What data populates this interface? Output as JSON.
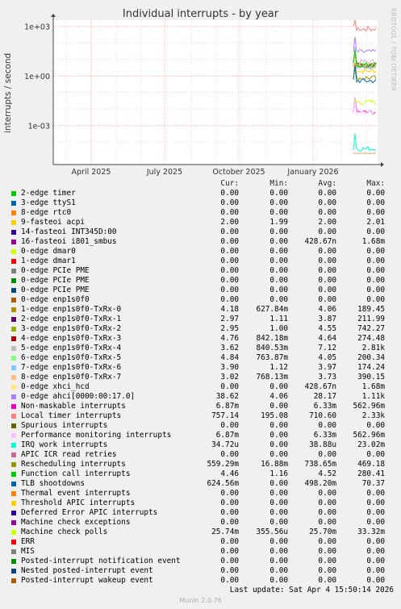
{
  "title": "Individual interrupts - by year",
  "side_label": "RRDTOOL / TOBI OETIKER",
  "footer": "Last update: Sat Apr  4 15:50:14 2026",
  "munin": "Munin 2.0.76",
  "legend_headers": {
    "cur": "Cur:",
    "min": "Min:",
    "avg": "Avg:",
    "max": "Max:"
  },
  "chart_data": {
    "type": "line",
    "title": "Individual interrupts - by year",
    "ylabel": "interrupts / second",
    "yscale": "log",
    "ylim": [
      2e-05,
      2000
    ],
    "y_ticks": [
      "1e+03",
      "1e+00",
      "1e-03"
    ],
    "x_ticks": [
      "April 2025",
      "July 2025",
      "October 2025",
      "January 2026"
    ],
    "grid": true,
    "series": [
      {
        "name": "2-edge timer",
        "color": "#00cc00",
        "cur": "0.00",
        "min": "0.00",
        "avg": "0.00",
        "max": "0.00"
      },
      {
        "name": "3-edge ttyS1",
        "color": "#0066b3",
        "cur": "0.00",
        "min": "0.00",
        "avg": "0.00",
        "max": "0.00"
      },
      {
        "name": "8-edge rtc0",
        "color": "#ff8000",
        "cur": "0.00",
        "min": "0.00",
        "avg": "0.00",
        "max": "0.00"
      },
      {
        "name": "9-fasteoi acpi",
        "color": "#ffcc00",
        "cur": "2.00",
        "min": "1.99",
        "avg": "2.00",
        "max": "2.01"
      },
      {
        "name": "14-fasteoi INT345D:00",
        "color": "#330099",
        "cur": "0.00",
        "min": "0.00",
        "avg": "0.00",
        "max": "0.00"
      },
      {
        "name": "16-fasteoi i801_smbus",
        "color": "#990099",
        "cur": "0.00",
        "min": "0.00",
        "avg": "428.67n",
        "max": "1.68m"
      },
      {
        "name": "0-edge dmar0",
        "color": "#ccff00",
        "cur": "0.00",
        "min": "0.00",
        "avg": "0.00",
        "max": "0.00"
      },
      {
        "name": "1-edge dmar1",
        "color": "#ff0000",
        "cur": "0.00",
        "min": "0.00",
        "avg": "0.00",
        "max": "0.00"
      },
      {
        "name": "0-edge PCIe PME",
        "color": "#808080",
        "cur": "0.00",
        "min": "0.00",
        "avg": "0.00",
        "max": "0.00"
      },
      {
        "name": "0-edge PCIe PME",
        "color": "#008f00",
        "cur": "0.00",
        "min": "0.00",
        "avg": "0.00",
        "max": "0.00"
      },
      {
        "name": "0-edge PCIe PME",
        "color": "#00487d",
        "cur": "0.00",
        "min": "0.00",
        "avg": "0.00",
        "max": "0.00"
      },
      {
        "name": "0-edge enp1s0f0",
        "color": "#b35a00",
        "cur": "0.00",
        "min": "0.00",
        "avg": "0.00",
        "max": "0.00"
      },
      {
        "name": "1-edge enp1s0f0-TxRx-0",
        "color": "#b38f00",
        "cur": "4.18",
        "min": "627.84m",
        "avg": "4.06",
        "max": "189.45"
      },
      {
        "name": "2-edge enp1s0f0-TxRx-1",
        "color": "#6b006b",
        "cur": "2.97",
        "min": "1.11",
        "avg": "3.87",
        "max": "211.99"
      },
      {
        "name": "3-edge enp1s0f0-TxRx-2",
        "color": "#8fb300",
        "cur": "2.95",
        "min": "1.00",
        "avg": "4.55",
        "max": "742.27"
      },
      {
        "name": "4-edge enp1s0f0-TxRx-3",
        "color": "#b30000",
        "cur": "4.76",
        "min": "842.18m",
        "avg": "4.64",
        "max": "274.48"
      },
      {
        "name": "5-edge enp1s0f0-TxRx-4",
        "color": "#bebebe",
        "cur": "3.62",
        "min": "840.53m",
        "avg": "7.12",
        "max": "2.81k"
      },
      {
        "name": "6-edge enp1s0f0-TxRx-5",
        "color": "#80ff80",
        "cur": "4.84",
        "min": "763.87m",
        "avg": "4.05",
        "max": "200.34"
      },
      {
        "name": "7-edge enp1s0f0-TxRx-6",
        "color": "#80c9ff",
        "cur": "3.90",
        "min": "1.12",
        "avg": "3.97",
        "max": "174.24"
      },
      {
        "name": "8-edge enp1s0f0-TxRx-7",
        "color": "#ffc080",
        "cur": "3.02",
        "min": "768.13m",
        "avg": "3.73",
        "max": "390.15"
      },
      {
        "name": "0-edge xhci_hcd",
        "color": "#ffe680",
        "cur": "0.00",
        "min": "0.00",
        "avg": "428.67n",
        "max": "1.68m"
      },
      {
        "name": "0-edge ahci[0000:00:17.0]",
        "color": "#aa80ff",
        "cur": "38.62",
        "min": "4.06",
        "avg": "28.17",
        "max": "1.11k"
      },
      {
        "name": "Non-maskable interrupts",
        "color": "#ee00cc",
        "cur": "6.87m",
        "min": "0.00",
        "avg": "6.33m",
        "max": "562.96m"
      },
      {
        "name": "Local timer interrupts",
        "color": "#ff8080",
        "cur": "757.14",
        "min": "195.08",
        "avg": "710.60",
        "max": "2.33k"
      },
      {
        "name": "Spurious interrupts",
        "color": "#666600",
        "cur": "0.00",
        "min": "0.00",
        "avg": "0.00",
        "max": "0.00"
      },
      {
        "name": "Performance monitoring interrupts",
        "color": "#ffbfff",
        "cur": "6.87m",
        "min": "0.00",
        "avg": "6.33m",
        "max": "562.96m"
      },
      {
        "name": "IRQ work interrupts",
        "color": "#00ffcc",
        "cur": "34.72u",
        "min": "0.00",
        "avg": "38.88u",
        "max": "23.02m"
      },
      {
        "name": "APIC ICR read retries",
        "color": "#cc6699",
        "cur": "0.00",
        "min": "0.00",
        "avg": "0.00",
        "max": "0.00"
      },
      {
        "name": "Rescheduling interrupts",
        "color": "#999900",
        "cur": "559.29m",
        "min": "16.88m",
        "avg": "738.65m",
        "max": "469.18"
      },
      {
        "name": "Function call interrupts",
        "color": "#00cc00",
        "cur": "4.46",
        "min": "1.16",
        "avg": "4.52",
        "max": "280.41"
      },
      {
        "name": "TLB shootdowns",
        "color": "#0066b3",
        "cur": "624.56m",
        "min": "0.00",
        "avg": "498.20m",
        "max": "70.37"
      },
      {
        "name": "Thermal event interrupts",
        "color": "#ff8000",
        "cur": "0.00",
        "min": "0.00",
        "avg": "0.00",
        "max": "0.00"
      },
      {
        "name": "Threshold APIC interrupts",
        "color": "#ffcc00",
        "cur": "0.00",
        "min": "0.00",
        "avg": "0.00",
        "max": "0.00"
      },
      {
        "name": "Deferred Error APIC interrupts",
        "color": "#330099",
        "cur": "0.00",
        "min": "0.00",
        "avg": "0.00",
        "max": "0.00"
      },
      {
        "name": "Machine check exceptions",
        "color": "#990099",
        "cur": "0.00",
        "min": "0.00",
        "avg": "0.00",
        "max": "0.00"
      },
      {
        "name": "Machine check polls",
        "color": "#ccff00",
        "cur": "25.74m",
        "min": "355.56u",
        "avg": "25.70m",
        "max": "33.32m"
      },
      {
        "name": "ERR",
        "color": "#ff0000",
        "cur": "0.00",
        "min": "0.00",
        "avg": "0.00",
        "max": "0.00"
      },
      {
        "name": "MIS",
        "color": "#808080",
        "cur": "0.00",
        "min": "0.00",
        "avg": "0.00",
        "max": "0.00"
      },
      {
        "name": "Posted-interrupt notification event",
        "color": "#008f00",
        "cur": "0.00",
        "min": "0.00",
        "avg": "0.00",
        "max": "0.00"
      },
      {
        "name": "Nested posted-interrupt event",
        "color": "#00487d",
        "cur": "0.00",
        "min": "0.00",
        "avg": "0.00",
        "max": "0.00"
      },
      {
        "name": "Posted-interrupt wakeup event",
        "color": "#b35a00",
        "cur": "0.00",
        "min": "0.00",
        "avg": "0.00",
        "max": "0.00"
      }
    ]
  }
}
